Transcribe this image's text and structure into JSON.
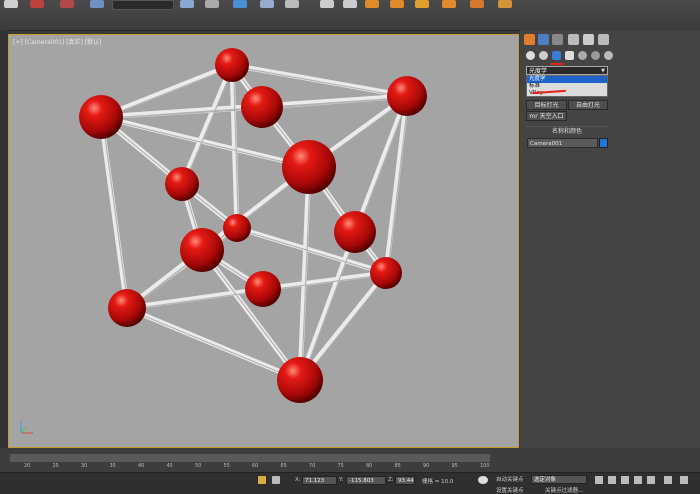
{
  "colors": {
    "viewport_bg": "#a4a4a4",
    "sphere": "#cc1010",
    "rod": "#e6e6e6",
    "accent_border": "#c89a28",
    "selection": "#1e64c8",
    "red_annotation": "#e0221a"
  },
  "viewport": {
    "label": "[+] [Camera001] [真实] [默认]"
  },
  "command_panel": {
    "tabs": [
      "create-icon",
      "modify-icon",
      "hierarchy-icon",
      "motion-icon",
      "display-icon",
      "utilities-icon"
    ],
    "dropdown": {
      "selected": "光度学",
      "options": [
        "光度学",
        "标准",
        "VRay"
      ]
    },
    "buttons": {
      "target_light": "目标灯光",
      "free_light": "自由灯光",
      "sky_portal": "mr 天空入口"
    },
    "name_color_rollout": "名称和颜色",
    "name_field_value": "Camera001"
  },
  "timeline": {
    "ticks": [
      "20",
      "25",
      "30",
      "35",
      "40",
      "45",
      "50",
      "55",
      "60",
      "65",
      "70",
      "75",
      "80",
      "85",
      "90",
      "95",
      "100"
    ]
  },
  "status_bar": {
    "x_label": "X:",
    "x_value": "71.123",
    "y_label": "Y:",
    "y_value": "-115.803",
    "z_label": "Z:",
    "z_value": "93.44",
    "grid": "栅格 = 10.0",
    "auto_key": "自动关键点",
    "selection_filter": "选定对象",
    "set_key": "设置关键点",
    "key_filters": "关键点过滤器..."
  }
}
